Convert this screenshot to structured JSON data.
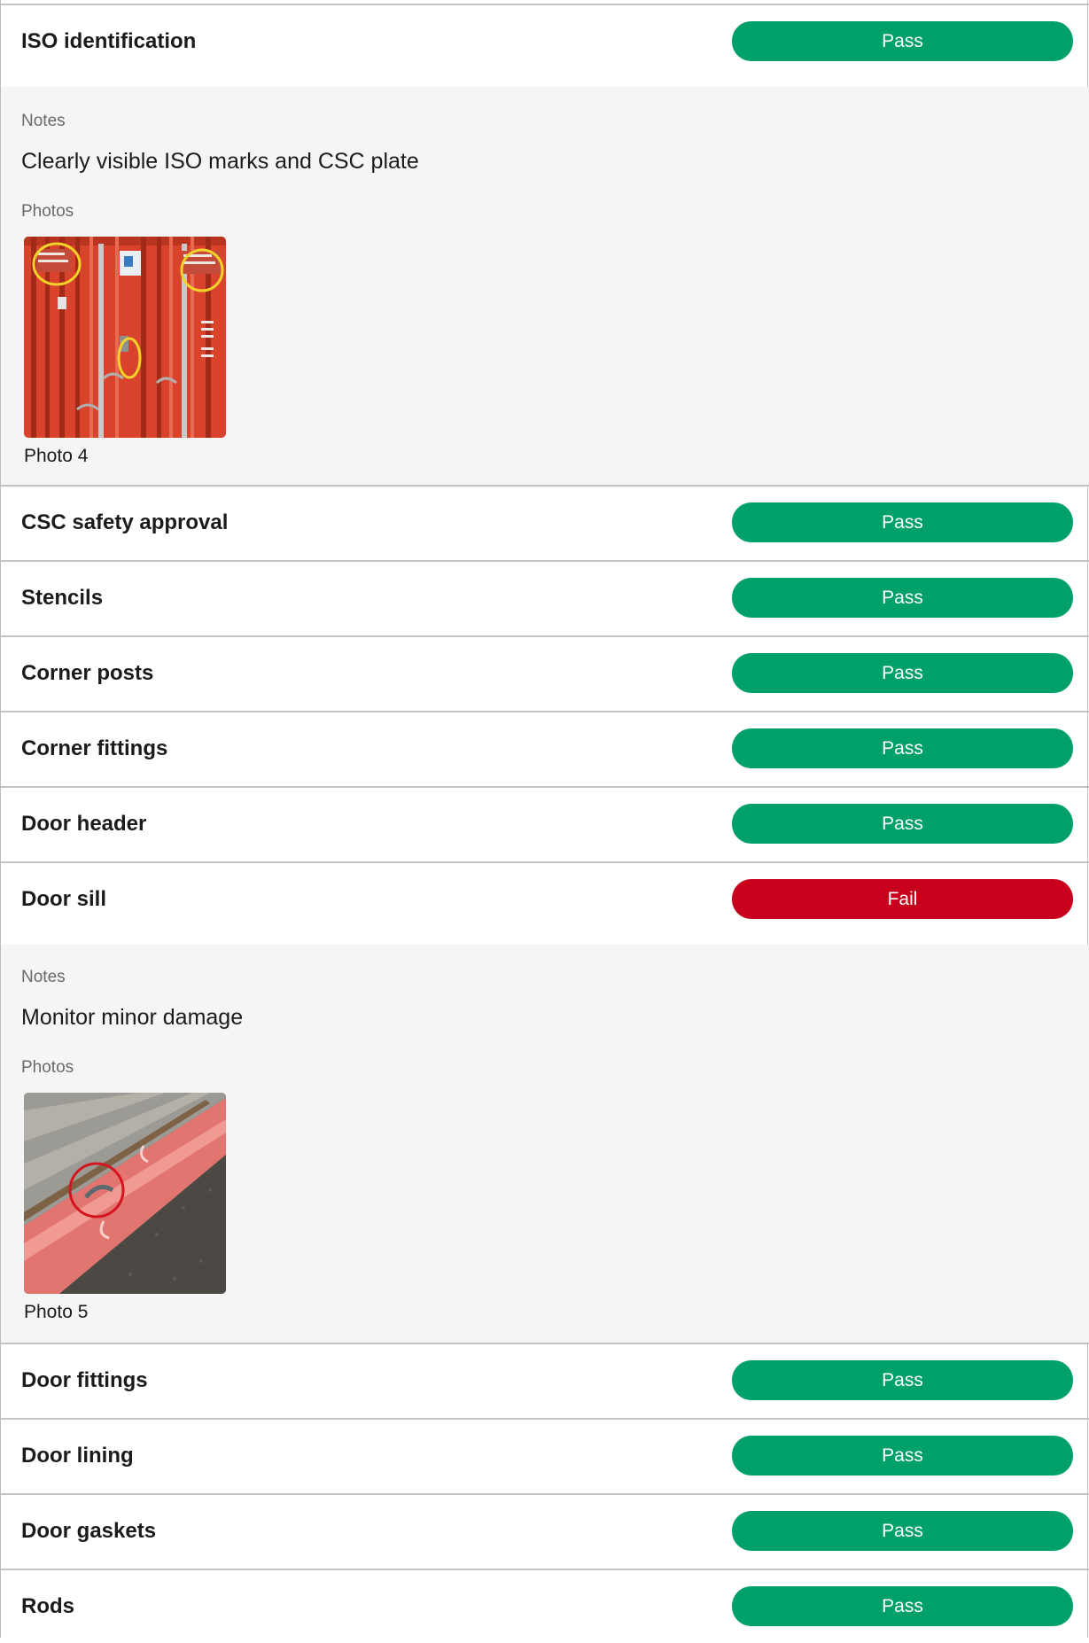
{
  "colors": {
    "pass": "#00a06a",
    "fail": "#c8001e",
    "details_bg": "#f5f5f5",
    "divider": "#c3c3c3"
  },
  "items": [
    {
      "label": "ISO identification",
      "status": "Pass",
      "notes_label": "Notes",
      "notes": "Clearly visible ISO marks and CSC plate",
      "photos_label": "Photos",
      "photo_caption": "Photo 4",
      "photo_icon": "container-door-photo"
    },
    {
      "label": "CSC safety approval",
      "status": "Pass"
    },
    {
      "label": "Stencils",
      "status": "Pass"
    },
    {
      "label": "Corner posts",
      "status": "Pass"
    },
    {
      "label": "Corner fittings",
      "status": "Pass"
    },
    {
      "label": "Door header",
      "status": "Pass"
    },
    {
      "label": "Door sill",
      "status": "Fail",
      "notes_label": "Notes",
      "notes": "Monitor minor damage",
      "photos_label": "Photos",
      "photo_caption": "Photo 5",
      "photo_icon": "door-sill-damage-photo"
    },
    {
      "label": "Door fittings",
      "status": "Pass"
    },
    {
      "label": "Door lining",
      "status": "Pass"
    },
    {
      "label": "Door gaskets",
      "status": "Pass"
    },
    {
      "label": "Rods",
      "status": "Pass"
    }
  ]
}
